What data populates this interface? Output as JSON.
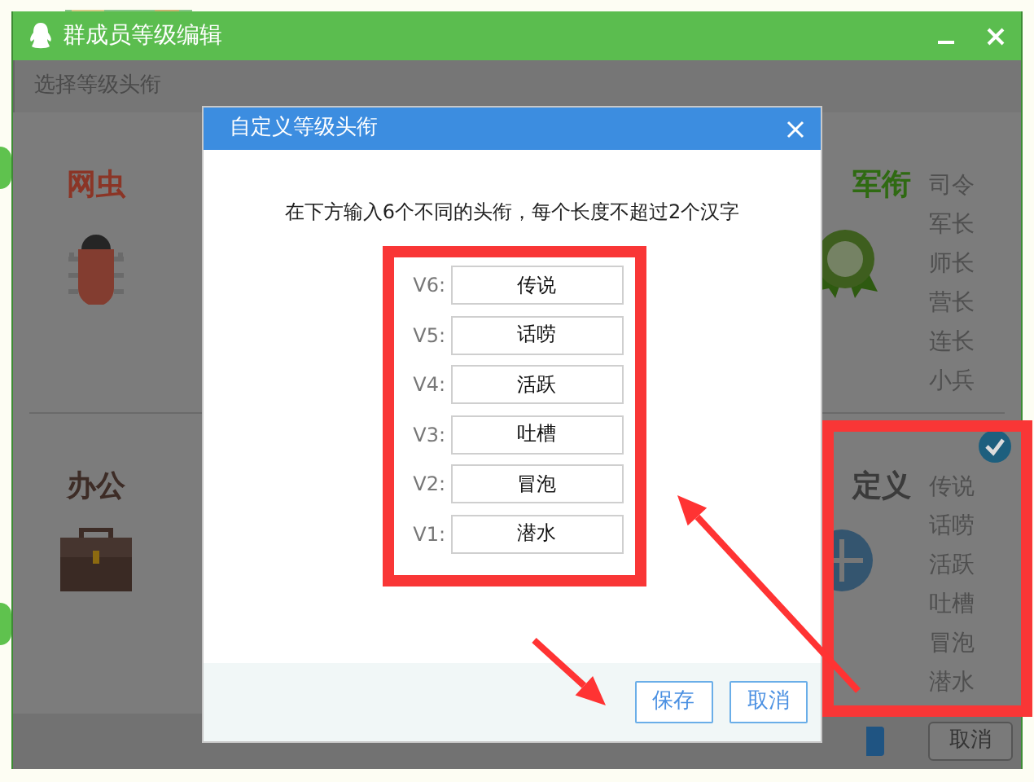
{
  "window": {
    "title": "群成员等级编辑"
  },
  "header": "选择等级头衔",
  "categories": [
    {
      "name": "网虫",
      "kind": "bug",
      "color": "#8b3526"
    },
    {
      "name": "军衔",
      "kind": "medal",
      "color": "#2f6a12",
      "selected": false,
      "titles": [
        "司令",
        "军长",
        "师长",
        "营长",
        "连长",
        "小兵"
      ]
    },
    {
      "name": "办公",
      "kind": "briefcase",
      "color": "#3d2c26"
    },
    {
      "name": "定义",
      "kind": "custom",
      "color": "#3b3b3b",
      "selected": true,
      "titles": [
        "传说",
        "话唠",
        "活跃",
        "吐槽",
        "冒泡",
        "潜水"
      ]
    }
  ],
  "footer": {
    "cancel": "取消"
  },
  "dialog": {
    "title": "自定义等级头衔",
    "instruction": "在下方输入6个不同的头衔，每个长度不超过2个汉字",
    "fields": [
      {
        "label": "V6:",
        "value": "传说"
      },
      {
        "label": "V5:",
        "value": "话唠"
      },
      {
        "label": "V4:",
        "value": "活跃"
      },
      {
        "label": "V3:",
        "value": "吐槽"
      },
      {
        "label": "V2:",
        "value": "冒泡"
      },
      {
        "label": "V1:",
        "value": "潜水"
      }
    ],
    "buttons": [
      "保存",
      "取消"
    ]
  }
}
